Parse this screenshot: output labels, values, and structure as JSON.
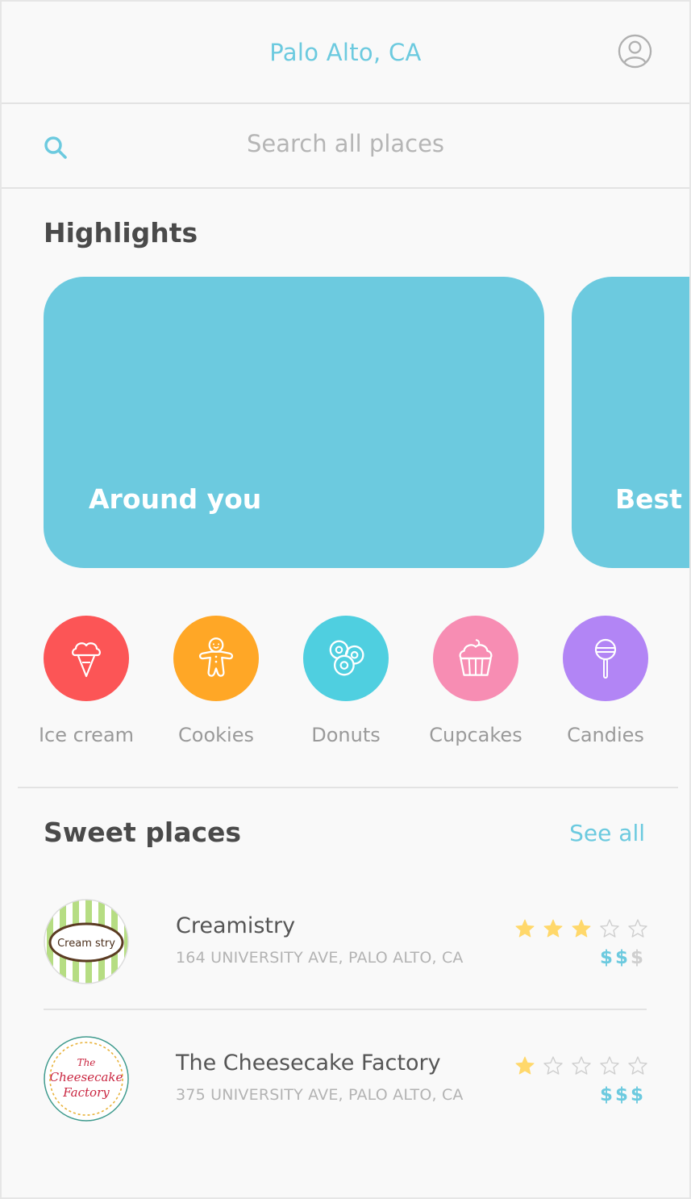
{
  "header": {
    "location": "Palo Alto, CA",
    "profile_icon": "user-circle-icon"
  },
  "search": {
    "placeholder": "Search all places",
    "icon": "search-icon"
  },
  "highlights": {
    "title": "Highlights",
    "cards": [
      {
        "label": "Around you"
      },
      {
        "label": "Best ra"
      }
    ]
  },
  "categories": [
    {
      "label": "Ice cream",
      "icon": "ice-cream-icon",
      "color": "#fc5556"
    },
    {
      "label": "Cookies",
      "icon": "gingerbread-icon",
      "color": "#ffa726"
    },
    {
      "label": "Donuts",
      "icon": "donuts-icon",
      "color": "#4fcfe0"
    },
    {
      "label": "Cupcakes",
      "icon": "cupcake-icon",
      "color": "#f78db3"
    },
    {
      "label": "Candies",
      "icon": "lollipop-icon",
      "color": "#b285f5"
    }
  ],
  "sweet_places": {
    "title": "Sweet places",
    "see_all": "See all",
    "items": [
      {
        "name": "Creamistry",
        "address": "164 UNIVERSITY AVE, PALO ALTO, CA",
        "logo_text": "Cream stry",
        "rating": 3,
        "max_rating": 5,
        "price_level": 2,
        "price_max": 3,
        "price_symbol": "$"
      },
      {
        "name": "The Cheesecake Factory",
        "address": "375 UNIVERSITY AVE, PALO ALTO, CA",
        "logo_text": "The Cheesecake Factory",
        "rating": 1,
        "max_rating": 5,
        "price_level": 3,
        "price_max": 3,
        "price_symbol": "$"
      }
    ]
  },
  "colors": {
    "accent": "#6ccadf",
    "star_on": "#ffd86b",
    "star_off": "#cfcfcf"
  }
}
